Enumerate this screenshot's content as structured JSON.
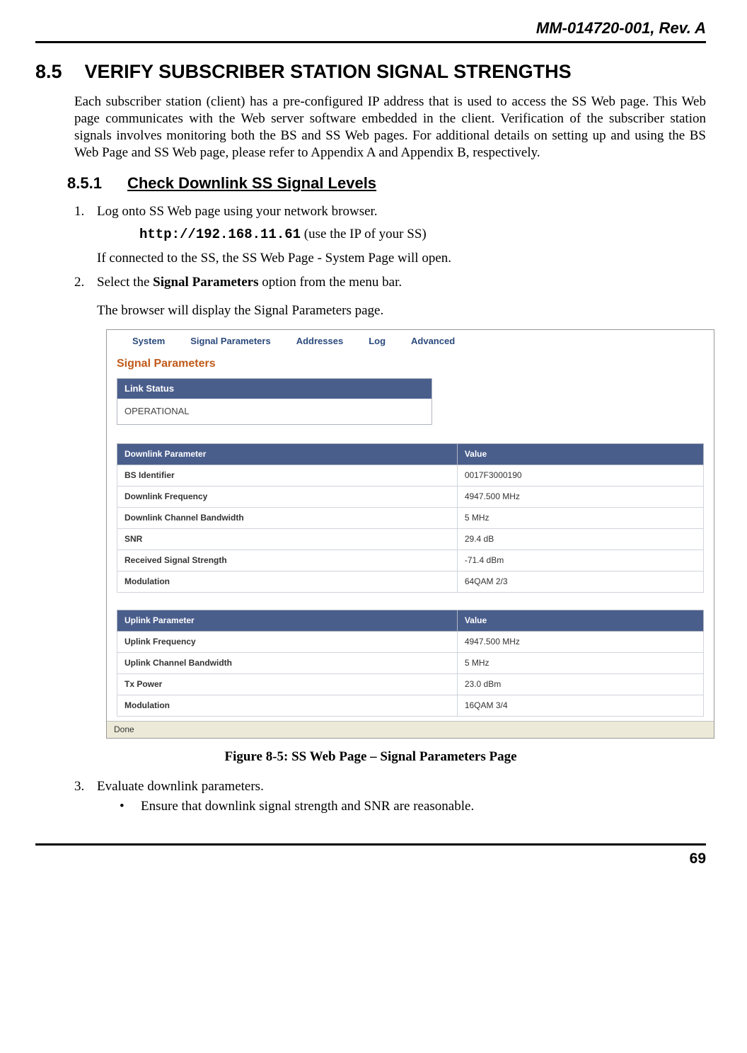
{
  "doc_header": "MM-014720-001, Rev. A",
  "section": {
    "num": "8.5",
    "title": "VERIFY SUBSCRIBER STATION SIGNAL STRENGTHS"
  },
  "intro": "Each subscriber station (client) has a pre-configured IP address that is used to access the SS Web page. This Web page communicates with the Web server software embedded in the client.  Verification of the subscriber station signals involves monitoring both the BS and SS Web pages.  For additional details on setting up and using the BS Web Page and SS Web page, please refer to Appendix A and Appendix B, respectively.",
  "subsection": {
    "num": "8.5.1",
    "title": "Check Downlink SS Signal Levels"
  },
  "steps": {
    "s1_num": "1.",
    "s1_text": "Log onto SS Web page using your network browser.",
    "s1_url": "http://192.168.11.61",
    "s1_hint": "  (use the IP of your SS)",
    "s1_after": "If connected to the SS, the SS Web Page - System Page will open.",
    "s2_num": "2.",
    "s2_pre": "Select the ",
    "s2_bold": "Signal Parameters",
    "s2_post": " option from the menu bar.",
    "s2_after": "The browser will display the Signal Parameters page.",
    "s3_num": "3.",
    "s3_text": "Evaluate downlink parameters.",
    "s3_bullet": "Ensure that downlink signal strength and SNR are reasonable."
  },
  "screenshot": {
    "menu": [
      "System",
      "Signal Parameters",
      "Addresses",
      "Log",
      "Advanced"
    ],
    "page_title": "Signal Parameters",
    "link_status_head": "Link Status",
    "link_status_value": "OPERATIONAL",
    "downlink_head_param": "Downlink Parameter",
    "uplink_head_param": "Uplink Parameter",
    "value_head": "Value",
    "downlink_rows": [
      {
        "p": "BS Identifier",
        "v": "0017F3000190"
      },
      {
        "p": "Downlink Frequency",
        "v": "4947.500 MHz"
      },
      {
        "p": "Downlink Channel Bandwidth",
        "v": "5 MHz"
      },
      {
        "p": "SNR",
        "v": "29.4 dB"
      },
      {
        "p": "Received Signal Strength",
        "v": "-71.4 dBm"
      },
      {
        "p": "Modulation",
        "v": "64QAM 2/3"
      }
    ],
    "uplink_rows": [
      {
        "p": "Uplink Frequency",
        "v": "4947.500 MHz"
      },
      {
        "p": "Uplink Channel Bandwidth",
        "v": "5 MHz"
      },
      {
        "p": "Tx Power",
        "v": "23.0 dBm"
      },
      {
        "p": "Modulation",
        "v": "16QAM 3/4"
      }
    ],
    "status_bar": "Done"
  },
  "figure_caption": "Figure 8-5:  SS Web Page – Signal Parameters Page",
  "page_number": "69"
}
